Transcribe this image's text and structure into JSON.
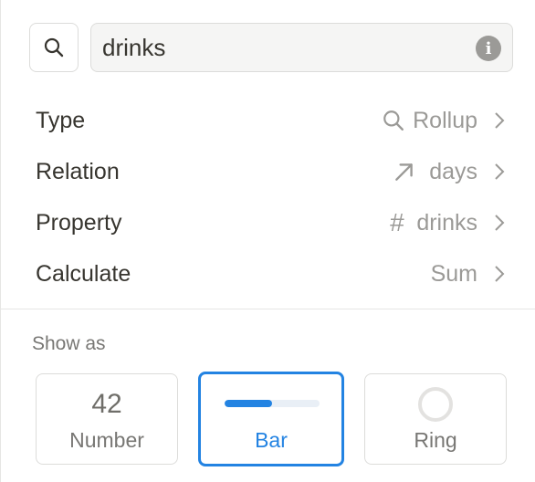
{
  "search": {
    "icon": "search-icon"
  },
  "name_field": {
    "value": "drinks",
    "icon": "info-icon",
    "info_glyph": "i"
  },
  "properties": [
    {
      "label": "Type",
      "value": "Rollup",
      "icon": "search-icon"
    },
    {
      "label": "Relation",
      "value": "days",
      "icon": "arrow-up-right-icon"
    },
    {
      "label": "Property",
      "value": "drinks",
      "icon": "hash-icon",
      "glyph": "#"
    },
    {
      "label": "Calculate",
      "value": "Sum",
      "icon": null
    }
  ],
  "show_as": {
    "label": "Show as",
    "options": [
      {
        "caption": "Number",
        "preview": "42",
        "selected": false
      },
      {
        "caption": "Bar",
        "preview_fill": 0.5,
        "selected": true
      },
      {
        "caption": "Ring",
        "selected": false
      }
    ]
  },
  "colors": {
    "accent": "#2383e2",
    "muted": "#9b9a97",
    "text": "#37352f"
  }
}
